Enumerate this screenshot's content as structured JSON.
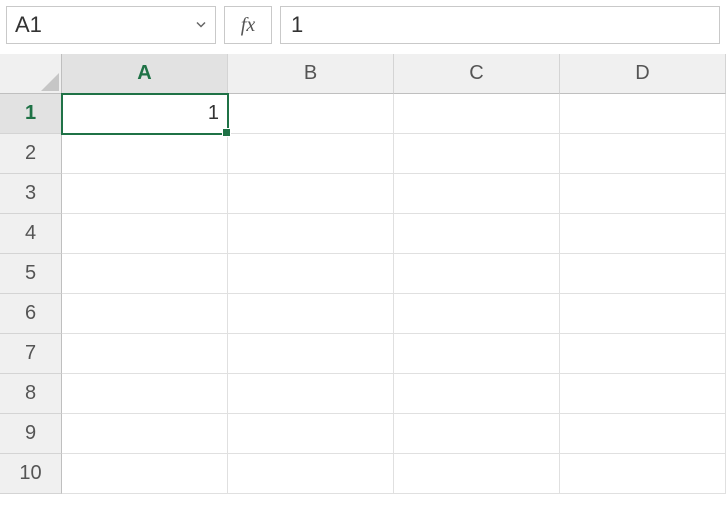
{
  "formula_bar": {
    "name_box_value": "A1",
    "fx_label": "fx",
    "formula_value": "1"
  },
  "columns": [
    "A",
    "B",
    "C",
    "D"
  ],
  "rows": [
    "1",
    "2",
    "3",
    "4",
    "5",
    "6",
    "7",
    "8",
    "9",
    "10"
  ],
  "selected_cell": {
    "col": "A",
    "row": "1"
  },
  "cells": {
    "A1": "1"
  }
}
